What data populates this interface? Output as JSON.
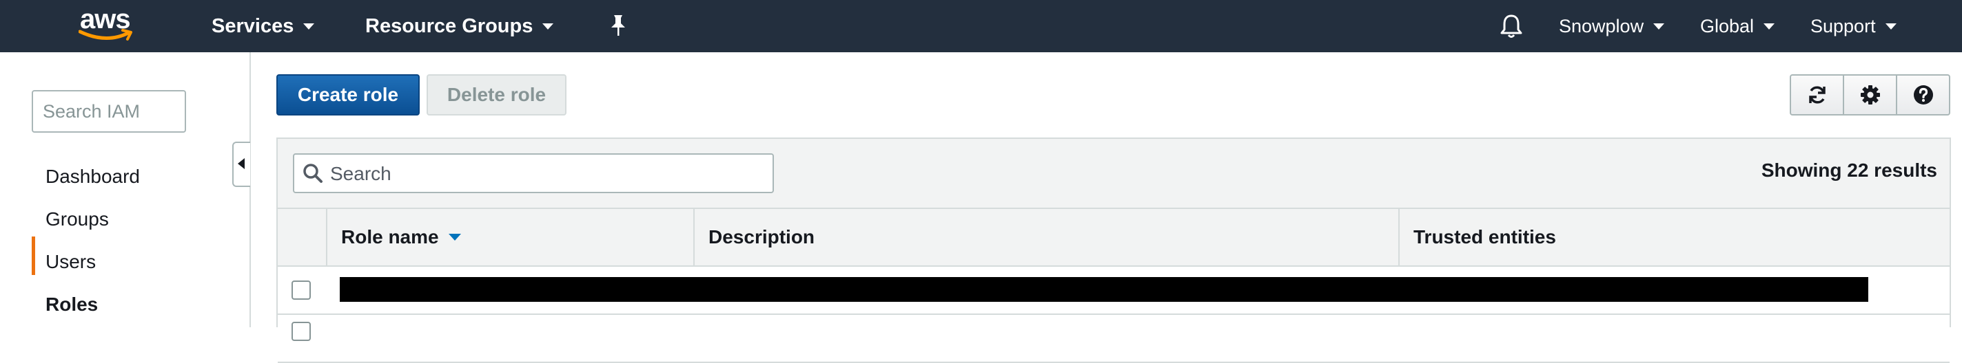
{
  "nav": {
    "logo_text": "aws",
    "services": "Services",
    "resource_groups": "Resource Groups",
    "account": "Snowplow",
    "region": "Global",
    "support": "Support"
  },
  "sidebar": {
    "search_placeholder": "Search IAM",
    "items": [
      {
        "label": "Dashboard"
      },
      {
        "label": "Groups"
      },
      {
        "label": "Users"
      },
      {
        "label": "Roles"
      }
    ]
  },
  "toolbar": {
    "create_label": "Create role",
    "delete_label": "Delete role"
  },
  "table": {
    "search_placeholder": "Search",
    "results": "Showing 22 results",
    "columns": [
      {
        "label": "Role name"
      },
      {
        "label": "Description"
      },
      {
        "label": "Trusted entities"
      }
    ]
  },
  "colors": {
    "nav_bg": "#232f3e",
    "primary": "#0b4f93",
    "active_accent": "#ec7211",
    "sort_icon": "#0073bb"
  }
}
